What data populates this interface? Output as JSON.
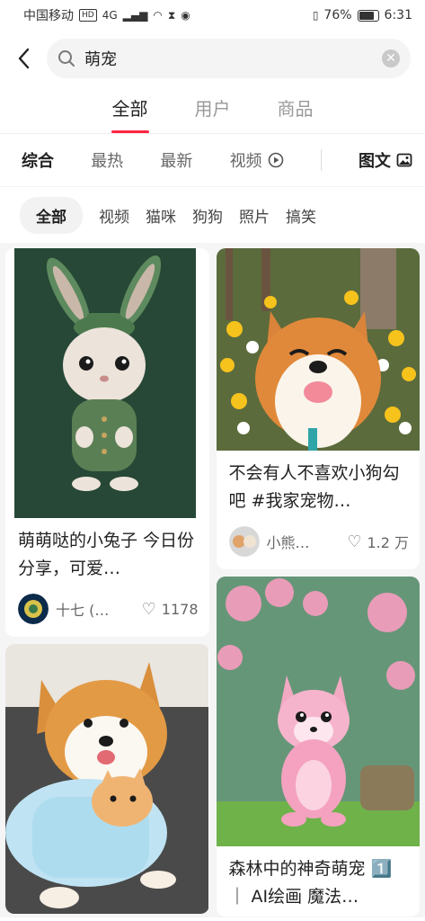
{
  "status": {
    "carrier": "中国移动",
    "hd": "HD",
    "network": "4G",
    "battery": "76%",
    "time": "6:31"
  },
  "search": {
    "query": "萌宠"
  },
  "tabs": [
    "全部",
    "用户",
    "商品"
  ],
  "sort": {
    "items": [
      "综合",
      "最热",
      "最新",
      "视频"
    ],
    "imagetext": "图文"
  },
  "chips": [
    "全部",
    "视频",
    "猫咪",
    "狗狗",
    "照片",
    "搞笑"
  ],
  "cards": [
    {
      "title": "萌萌哒的小兔子 今日份 分享，可爱…",
      "author": "十七 (…",
      "likes": "1178"
    },
    {
      "title": "不会有人不喜欢小狗勾吧 #我家宠物…",
      "author": "小熊…",
      "likes": "1.2 万"
    },
    {
      "title": "森林中的神奇萌宠 1️⃣ ｜ AI绘画 魔法…"
    }
  ],
  "colors": {
    "accent": "#ff2442"
  }
}
